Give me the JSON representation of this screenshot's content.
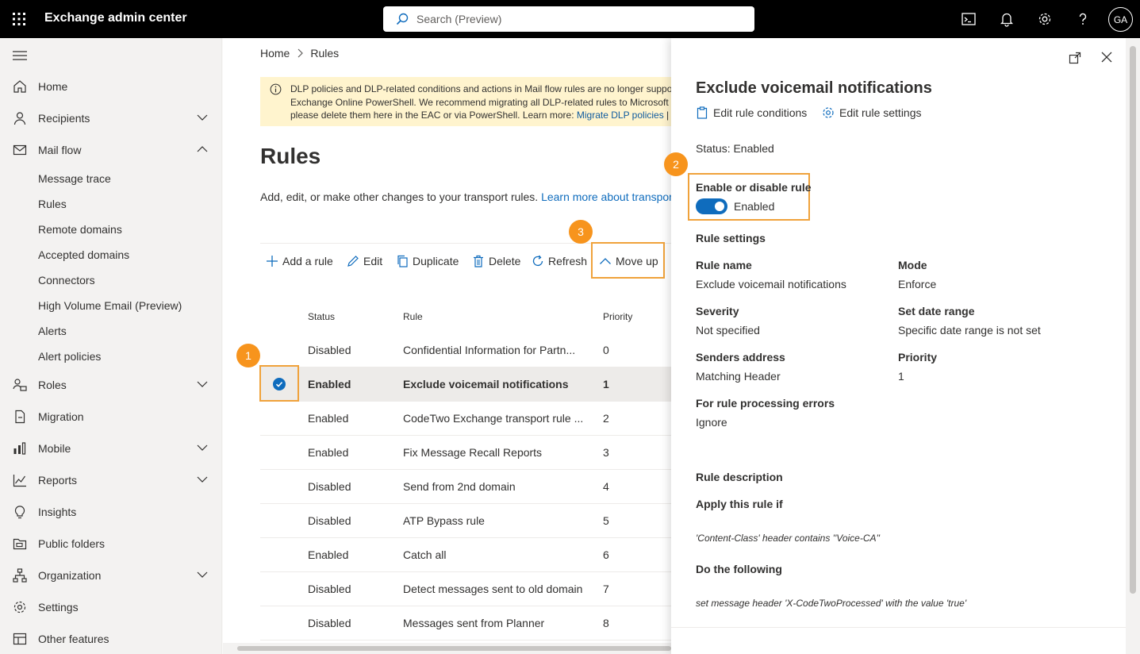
{
  "topbar": {
    "title": "Exchange admin center",
    "search_placeholder": "Search (Preview)",
    "avatar": "GA",
    "icons": [
      "app-launcher-icon",
      "terminal-icon",
      "bell-icon",
      "gear-icon",
      "help-icon"
    ]
  },
  "nav": {
    "items": [
      {
        "label": "Home",
        "icon": "home-icon"
      },
      {
        "label": "Recipients",
        "icon": "person-icon"
      },
      {
        "label": "Mail flow",
        "icon": "mail-icon"
      },
      {
        "label": "Roles",
        "icon": "roles-icon"
      },
      {
        "label": "Migration",
        "icon": "migration-icon"
      },
      {
        "label": "Mobile",
        "icon": "mobile-icon"
      },
      {
        "label": "Reports",
        "icon": "chart-icon"
      },
      {
        "label": "Insights",
        "icon": "lightbulb-icon"
      },
      {
        "label": "Public folders",
        "icon": "folder-icon"
      },
      {
        "label": "Organization",
        "icon": "org-icon"
      },
      {
        "label": "Settings",
        "icon": "gear-icon"
      },
      {
        "label": "Other features",
        "icon": "grid-icon"
      }
    ],
    "mailflow_subitems": [
      "Message trace",
      "Rules",
      "Remote domains",
      "Accepted domains",
      "Connectors",
      "High Volume Email (Preview)",
      "Alerts",
      "Alert policies"
    ]
  },
  "main": {
    "breadcrumb": {
      "home": "Home",
      "current": "Rules"
    },
    "banner": {
      "line1": "DLP policies and DLP-related conditions and actions in Mail flow rules are no longer suppor",
      "line2": "Exchange Online PowerShell. We recommend migrating all DLP-related rules to Microsoft P",
      "line3_text": "please delete them here in the EAC or via PowerShell. Learn more: ",
      "line3_link": "Migrate DLP policies",
      "line3_sep": " |  N"
    },
    "title": "Rules",
    "description": "Add, edit, or make other changes to your transport rules. ",
    "description_link": "Learn more about transpor",
    "commands": {
      "add": "Add a rule",
      "edit": "Edit",
      "duplicate": "Duplicate",
      "delete": "Delete",
      "refresh": "Refresh",
      "move_up": "Move up"
    },
    "table": {
      "headers": {
        "status": "Status",
        "rule": "Rule",
        "priority": "Priority"
      },
      "rows": [
        {
          "status": "Disabled",
          "rule": "Confidential Information for Partn...",
          "priority": "0"
        },
        {
          "status": "Enabled",
          "rule": "Exclude voicemail notifications",
          "priority": "1"
        },
        {
          "status": "Enabled",
          "rule": "CodeTwo Exchange transport rule ...",
          "priority": "2"
        },
        {
          "status": "Enabled",
          "rule": "Fix Message Recall Reports",
          "priority": "3"
        },
        {
          "status": "Disabled",
          "rule": "Send from 2nd domain",
          "priority": "4"
        },
        {
          "status": "Disabled",
          "rule": "ATP Bypass rule",
          "priority": "5"
        },
        {
          "status": "Enabled",
          "rule": "Catch all",
          "priority": "6"
        },
        {
          "status": "Disabled",
          "rule": "Detect messages sent to old domain",
          "priority": "7"
        },
        {
          "status": "Disabled",
          "rule": "Messages sent from Planner",
          "priority": "8"
        }
      ]
    },
    "badges": {
      "b1": "1",
      "b2": "2",
      "b3": "3"
    }
  },
  "panel": {
    "title": "Exclude voicemail notifications",
    "edit_conditions": "Edit rule conditions",
    "edit_settings": "Edit rule settings",
    "status": "Status: Enabled",
    "enable_label": "Enable or disable rule",
    "toggle_state": "Enabled",
    "rule_settings": "Rule settings",
    "fields": {
      "rule_name_label": "Rule name",
      "rule_name": "Exclude voicemail notifications",
      "mode_label": "Mode",
      "mode": "Enforce",
      "severity_label": "Severity",
      "severity": "Not specified",
      "date_label": "Set date range",
      "date": "Specific date range is not set",
      "senders_label": "Senders address",
      "senders": "Matching Header",
      "priority_label": "Priority",
      "priority": "1",
      "errors_label": "For rule processing errors",
      "errors": "Ignore"
    },
    "description_title": "Rule description",
    "apply_label": "Apply this rule if",
    "condition": "'Content-Class' header contains ''Voice-CA''",
    "do_label": "Do the following",
    "action": "set message header 'X-CodeTwoProcessed' with the value 'true'"
  },
  "colors": {
    "accent": "#0f6cbd",
    "highlight": "#f0a23b",
    "badge": "#f7941d",
    "banner": "#fff4ce"
  }
}
